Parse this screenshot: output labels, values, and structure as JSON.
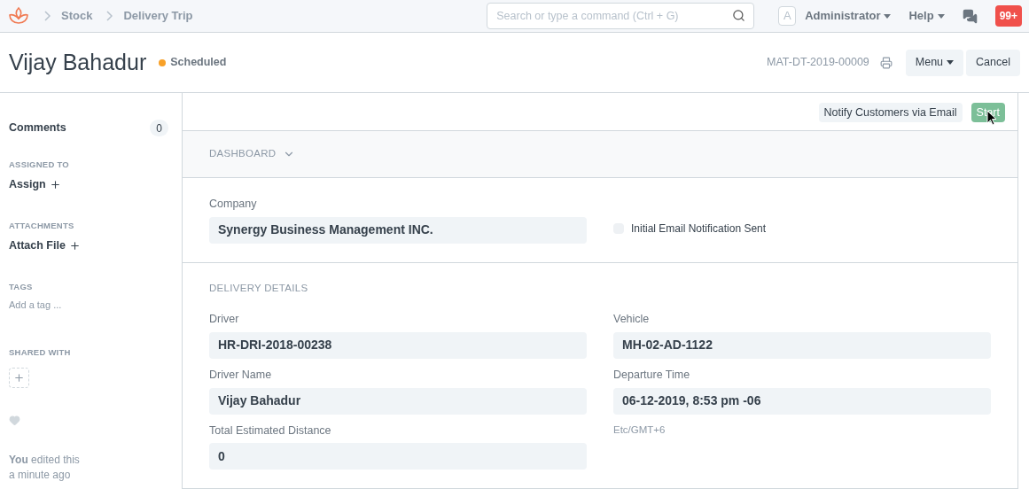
{
  "navbar": {
    "breadcrumbs": [
      "Stock",
      "Delivery Trip"
    ],
    "search": {
      "placeholder": "Search or type a command (Ctrl + G)"
    },
    "avatar": "A",
    "user": "Administrator",
    "help": "Help",
    "notifications": "99+"
  },
  "header": {
    "title": "Vijay Bahadur",
    "status": {
      "label": "Scheduled",
      "color": "#f8a128"
    },
    "doc_name": "MAT-DT-2019-00009",
    "menu": "Menu",
    "cancel": "Cancel"
  },
  "sidebar": {
    "comments": {
      "label": "Comments",
      "count": "0"
    },
    "assigned_to": {
      "heading": "ASSIGNED TO",
      "action": "Assign"
    },
    "attachments": {
      "heading": "ATTACHMENTS",
      "action": "Attach File"
    },
    "tags": {
      "heading": "TAGS",
      "placeholder": "Add a tag ..."
    },
    "shared_with": {
      "heading": "SHARED WITH"
    },
    "activity": [
      "**You** edited this",
      "a minute ago"
    ]
  },
  "toolbar": [
    {
      "label": "Notify Customers via Email",
      "kind": "default"
    },
    {
      "label": "Start",
      "kind": "primary"
    }
  ],
  "sections": [
    {
      "kind": "collapsible",
      "heading": "DASHBOARD",
      "expanded": false
    },
    {
      "kind": "form",
      "columns": [
        [
          {
            "kind": "data",
            "label": "Company",
            "value": "Synergy Business Management INC."
          }
        ],
        [
          {
            "kind": "checkbox",
            "label": "Initial Email Notification Sent",
            "checked": false
          }
        ]
      ]
    },
    {
      "kind": "form",
      "heading": "DELIVERY DETAILS",
      "columns": [
        [
          {
            "kind": "data",
            "label": "Driver",
            "value": "HR-DRI-2018-00238"
          },
          {
            "kind": "data",
            "label": "Driver Name",
            "value": "Vijay Bahadur"
          },
          {
            "kind": "data",
            "label": "Total Estimated Distance",
            "value": "0"
          }
        ],
        [
          {
            "kind": "data",
            "label": "Vehicle",
            "value": "MH-02-AD-1122"
          },
          {
            "kind": "data",
            "label": "Departure Time",
            "value": "06-12-2019, 8:53 pm -06"
          },
          {
            "kind": "note",
            "text": "Etc/GMT+6"
          }
        ]
      ]
    }
  ]
}
